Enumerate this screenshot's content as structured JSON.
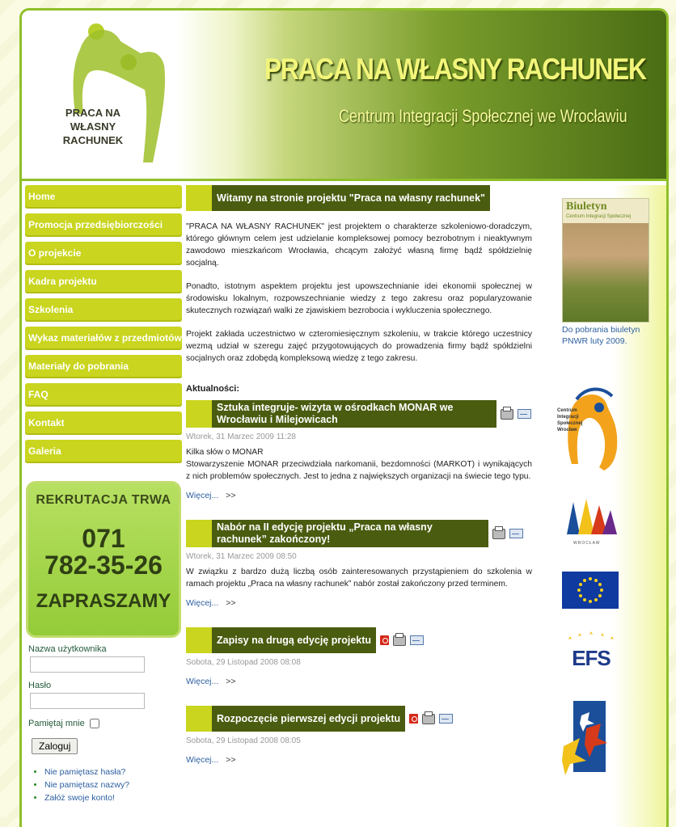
{
  "header": {
    "logo_text": [
      "PRACA NA",
      "WŁASNY",
      "RACHUNEK"
    ],
    "title": "PRACA NA WŁASNY RACHUNEK",
    "subtitle": "Centrum Integracji Społecznej we Wrocławiu"
  },
  "nav": {
    "items": [
      "Home",
      "Promocja przedsiębiorczości",
      "O projekcie",
      "Kadra projektu",
      "Szkolenia",
      "Wykaz materiałów z przedmiotów",
      "Materiały do pobrania",
      "FAQ",
      "Kontakt",
      "Galeria"
    ]
  },
  "recruit": {
    "line1": "REKRUTACJA TRWA",
    "line2": "071",
    "line3": "782-35-26",
    "line4": "ZAPRASZAMY"
  },
  "login": {
    "username_label": "Nazwa użytkownika",
    "username_value": "",
    "password_label": "Hasło",
    "password_value": "",
    "remember_label": "Pamiętaj mnie",
    "remember_checked": false,
    "submit_label": "Zaloguj",
    "links": [
      "Nie pamiętasz hasła?",
      "Nie pamiętasz nazwy?",
      "Załóż swoje konto!"
    ]
  },
  "main": {
    "welcome_title": "Witamy na stronie projektu \"Praca na własny rachunek\"",
    "intro": [
      "  \"PRACA NA WŁASNY RACHUNEK\" jest projektem o charakterze szkoleniowo-doradczym, którego głównym celem jest udzielanie kompleksowej pomocy bezrobotnym i nieaktywnym zawodowo mieszkańcom Wrocławia, chcącym założyć własną firmę bądź spółdzielnię socjalną.",
      "Ponadto, istotnym aspektem projektu jest upowszechnianie idei ekonomii społecznej w środowisku lokalnym, rozpowszechnianie wiedzy z tego zakresu oraz popularyzowanie skutecznych rozwiązań walki ze zjawiskiem bezrobocia i wykluczenia społecznego.",
      "Projekt zakłada uczestnictwo w czteromiesięcznym szkoleniu, w trakcie którego uczestnicy wezmą udział w szeregu zajęć przygotowujących do prowadzenia firmy bądź spółdzielni socjalnych oraz zdobędą kompleksową wiedzę z tego zakresu."
    ],
    "news_heading": "Aktualności:",
    "more_label": "Więcej...",
    "more_arrow": ">>",
    "articles": [
      {
        "title": "Sztuka integruje- wizyta w ośrodkach MONAR we Wrocławiu i Milejowicach",
        "date": "Wtorek, 31 Marzec 2009 11:28",
        "body": "Kilka słów o MONAR\nStowarzyszenie MONAR przeciwdziała narkomanii, bezdomności (MARKOT) i wynikających z nich problemów społecznych. Jest to jedna z największych organizacji na świecie tego typu."
      },
      {
        "title": "Nabór na II edycję projektu „Praca na własny rachunek” zakończony!",
        "date": "Wtorek, 31 Marzec 2009 08:50",
        "body": "W związku z bardzo dużą liczbą osób zainteresowanych przystąpieniem do szkolenia w ramach projektu „Praca na własny rachunek” nabór został zakończony przed terminem."
      },
      {
        "title": "Zapisy na drugą edycję projektu",
        "date": "Sobota, 29 Listopad 2008 08:08",
        "body": ""
      },
      {
        "title": "Rozpoczęcie pierwszej edycji projektu",
        "date": "Sobota, 29 Listopad 2008 08:05",
        "body": ""
      }
    ]
  },
  "sidebar_right": {
    "bulletin_title": "Biuletyn",
    "bulletin_subtitle": "Centrum Integracji Społecznej",
    "bulletin_caption": "Do pobrania biuletyn PNWR luty 2009.",
    "cis_logo_text": [
      "Centrum",
      "Integracji",
      "Społecznej",
      "Wrocław"
    ],
    "wroclaw_text": "WROCŁAW",
    "efs_text": "EFS"
  },
  "colors": {
    "accent_green": "#8fbf2a",
    "nav_yellow_green": "#c9d51e",
    "title_dark_green": "#4a5c10",
    "link_blue": "#2c5fa0"
  }
}
